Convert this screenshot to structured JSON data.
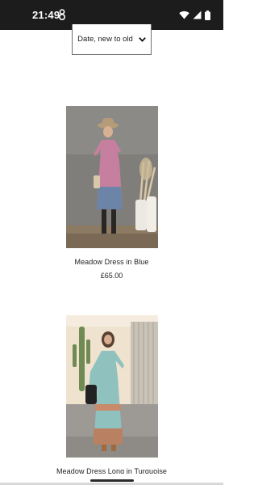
{
  "status_bar": {
    "time": "21:49",
    "icons": [
      "app-notification-icon",
      "wifi-icon",
      "cellular-signal-icon",
      "battery-icon"
    ]
  },
  "sort": {
    "selected": "Date, new to old",
    "icon": "chevron-down-icon"
  },
  "products": [
    {
      "name": "Meadow Dress in Blue",
      "price": "£65.00"
    },
    {
      "name": "Meadow Dress Long in Turquoise",
      "price": ""
    }
  ],
  "colors": {
    "status_bar_bg": "#1c1c1c",
    "text": "#222222",
    "border": "#6f6f6f"
  }
}
